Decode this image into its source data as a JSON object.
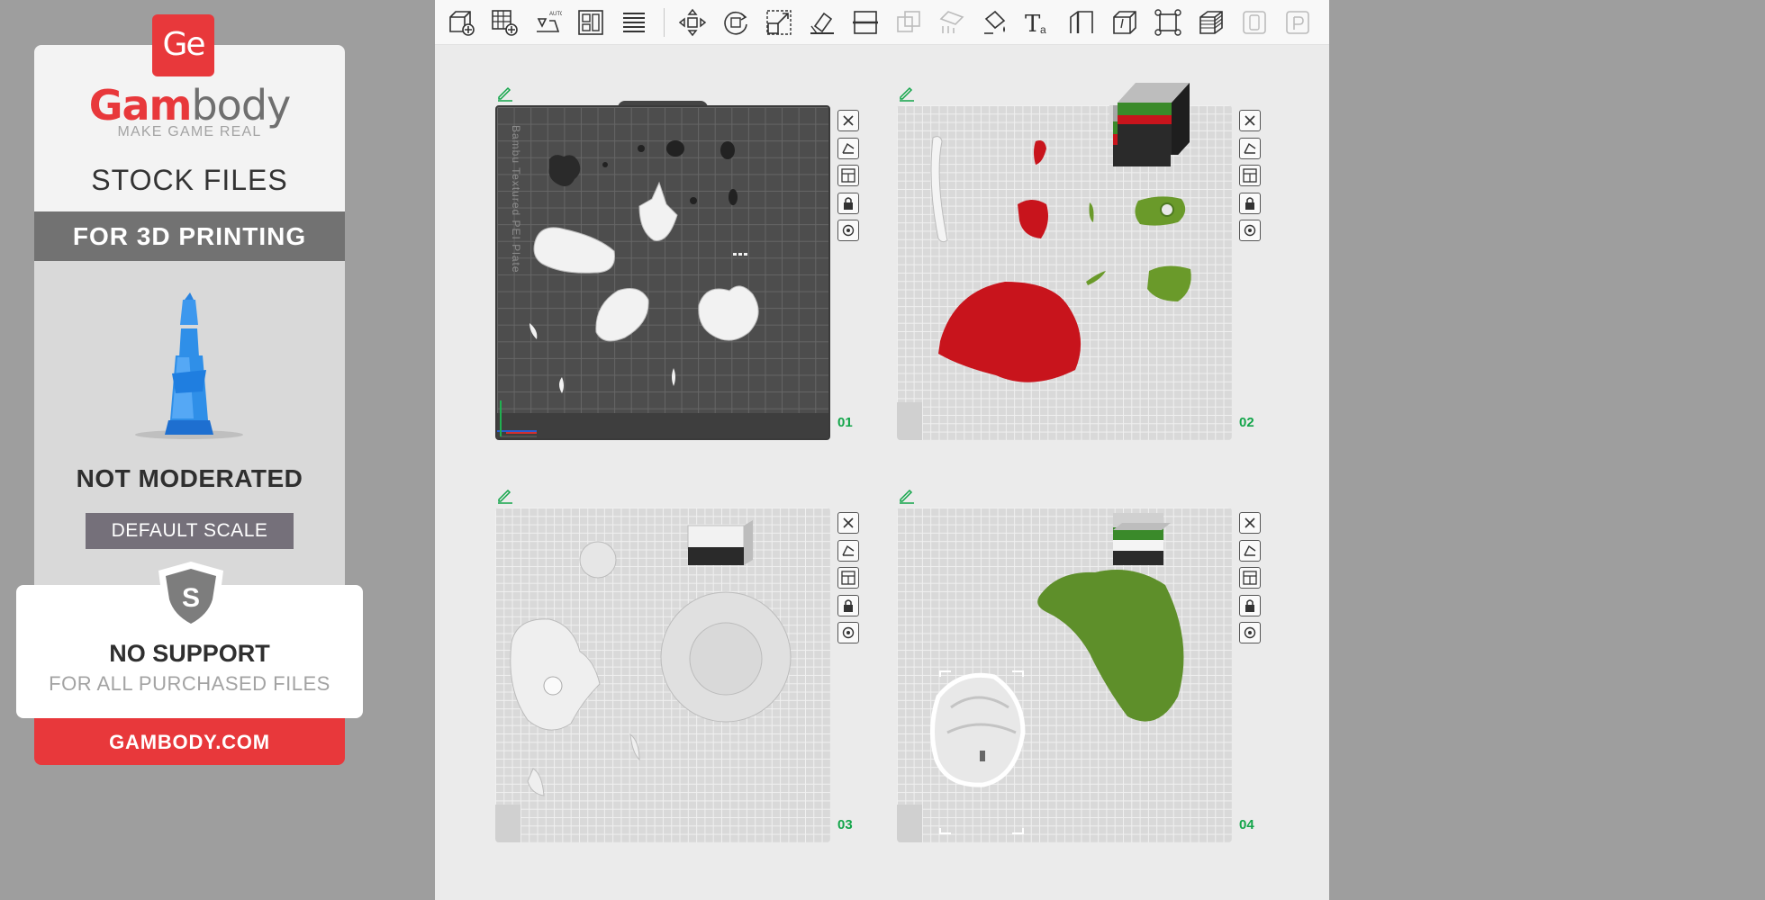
{
  "promo": {
    "logo_mark": "Ge",
    "brand_red": "Gam",
    "brand_gray": "body",
    "tagline": "MAKE GAME REAL",
    "stock_title": "STOCK FILES",
    "for_printing": "FOR 3D PRINTING",
    "not_moderated": "NOT MODERATED",
    "default_scale": "DEFAULT SCALE",
    "shield_letter": "S",
    "no_support": "NO SUPPORT",
    "all_files": "FOR ALL PURCHASED FILES",
    "site": "GAMBODY.COM",
    "colors": {
      "accent": "#e8383b",
      "gray_bar": "#727272",
      "scale_bar": "#75707a",
      "figure": "#2f8fe8"
    }
  },
  "toolbar": {
    "tools": [
      {
        "icon": "add-object-icon",
        "enabled": true
      },
      {
        "icon": "add-plate-icon",
        "enabled": true
      },
      {
        "icon": "auto-orient-icon",
        "enabled": true,
        "badge": "AUTO"
      },
      {
        "icon": "arrange-icon",
        "enabled": true
      },
      {
        "icon": "split-plate-icon",
        "enabled": true
      },
      {
        "icon": "move-icon",
        "enabled": true
      },
      {
        "icon": "rotate-icon",
        "enabled": true
      },
      {
        "icon": "scale-icon",
        "enabled": true
      },
      {
        "icon": "lay-on-face-icon",
        "enabled": true
      },
      {
        "icon": "cut-icon",
        "enabled": true
      },
      {
        "icon": "boolean-icon",
        "enabled": false
      },
      {
        "icon": "support-paint-icon",
        "enabled": false
      },
      {
        "icon": "color-paint-icon",
        "enabled": true
      },
      {
        "icon": "text-icon",
        "enabled": true,
        "badge": "Ta"
      },
      {
        "icon": "seam-icon",
        "enabled": true
      },
      {
        "icon": "measure-icon",
        "enabled": true
      },
      {
        "icon": "fit-view-icon",
        "enabled": true
      },
      {
        "icon": "layers-icon",
        "enabled": true
      },
      {
        "icon": "assembly-icon",
        "enabled": false
      },
      {
        "icon": "preview-icon",
        "enabled": false
      }
    ]
  },
  "plates": [
    {
      "number": "01",
      "style": "dark",
      "label": "Bambu Textured PEI Plate"
    },
    {
      "number": "02",
      "style": "light"
    },
    {
      "number": "03",
      "style": "light"
    },
    {
      "number": "04",
      "style": "light"
    }
  ],
  "plate_tools": [
    "close-icon",
    "orient-plate-icon",
    "arrange-plate-icon",
    "lock-icon",
    "settings-icon"
  ]
}
